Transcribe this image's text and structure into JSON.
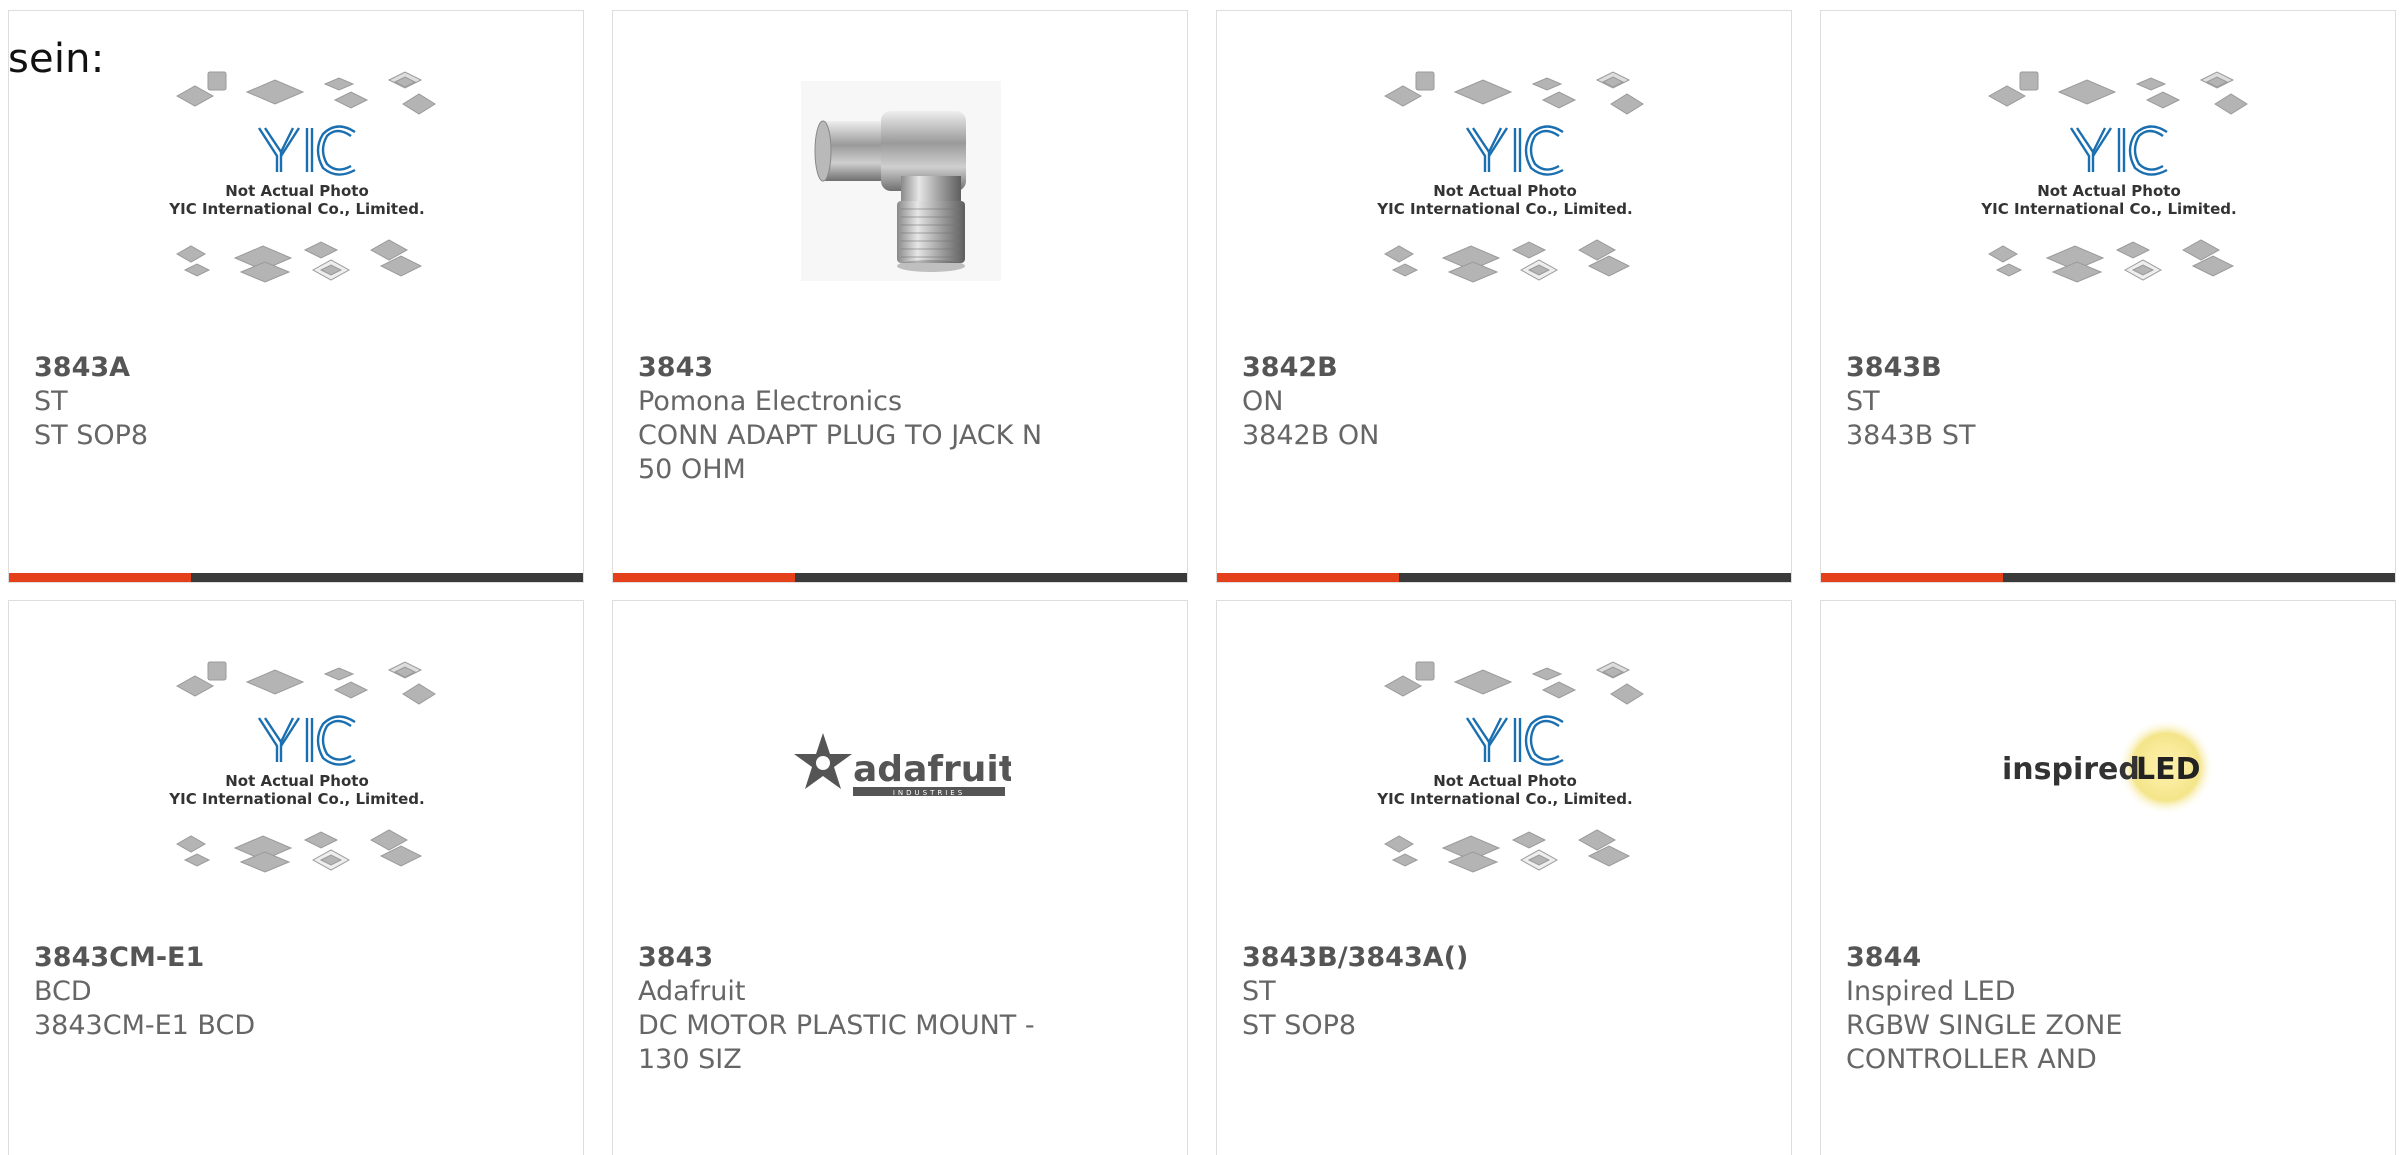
{
  "header": {
    "lead_text": "sein:"
  },
  "placeholder_image": {
    "line1": "Not Actual Photo",
    "line2": "YIC International Co., Limited.",
    "logo_text": "YIC"
  },
  "products": [
    {
      "part": "3843A",
      "maker": "ST",
      "desc": "ST SOP8",
      "image": "yic-placeholder"
    },
    {
      "part": "3843",
      "maker": "Pomona Electronics",
      "desc": "CONN ADAPT PLUG TO JACK N 50 OHM",
      "image": "rf-adapter-photo"
    },
    {
      "part": "3842B",
      "maker": "ON",
      "desc": "3842B ON",
      "image": "yic-placeholder"
    },
    {
      "part": "3843B",
      "maker": "ST",
      "desc": "3843B ST",
      "image": "yic-placeholder"
    },
    {
      "part": "3843CM-E1",
      "maker": "BCD",
      "desc": "3843CM-E1 BCD",
      "image": "yic-placeholder"
    },
    {
      "part": "3843",
      "maker": "Adafruit",
      "desc": "DC MOTOR PLASTIC MOUNT - 130 SIZ",
      "image": "adafruit-logo",
      "logo_text": "adafruit",
      "logo_sub": "INDUSTRIES"
    },
    {
      "part": "3843B/3843A()",
      "maker": "ST",
      "desc": "ST SOP8",
      "image": "yic-placeholder"
    },
    {
      "part": "3844",
      "maker": "Inspired LED",
      "desc": "RGBW SINGLE ZONE CONTROLLER AND",
      "image": "inspired-led-logo",
      "logo_text_a": "inspired",
      "logo_text_b": "LED"
    }
  ],
  "colors": {
    "accent": "#e4401c",
    "bar": "#3a3a3a",
    "card_border": "#dddddd",
    "text": "#666666",
    "yic_blue": "#1a6fb0"
  }
}
